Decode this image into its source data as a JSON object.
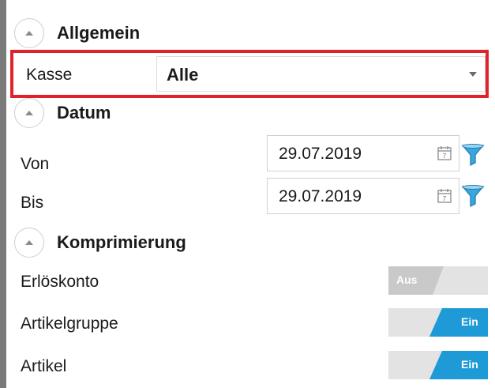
{
  "sections": {
    "allgemein": {
      "title": "Allgemein"
    },
    "datum": {
      "title": "Datum"
    },
    "komprimierung": {
      "title": "Komprimierung"
    }
  },
  "kasse": {
    "label": "Kasse",
    "value": "Alle"
  },
  "datum": {
    "von": {
      "label": "Von",
      "value": "29.07.2019"
    },
    "bis": {
      "label": "Bis",
      "value": "29.07.2019"
    }
  },
  "komprimierung": {
    "erloeskonto": {
      "label": "Erlöskonto",
      "state": "Aus"
    },
    "artikelgruppe": {
      "label": "Artikelgruppe",
      "state": "Ein"
    },
    "artikel": {
      "label": "Artikel",
      "state": "Ein"
    }
  },
  "colors": {
    "highlight_border": "#e0232b",
    "toggle_on": "#1e9ad6",
    "toggle_off": "#c9c9c9",
    "funnel": "#3aa6dd"
  },
  "icons": [
    "collapse-up-icon",
    "calendar-icon",
    "filter-funnel-icon",
    "dropdown-caret-icon"
  ]
}
